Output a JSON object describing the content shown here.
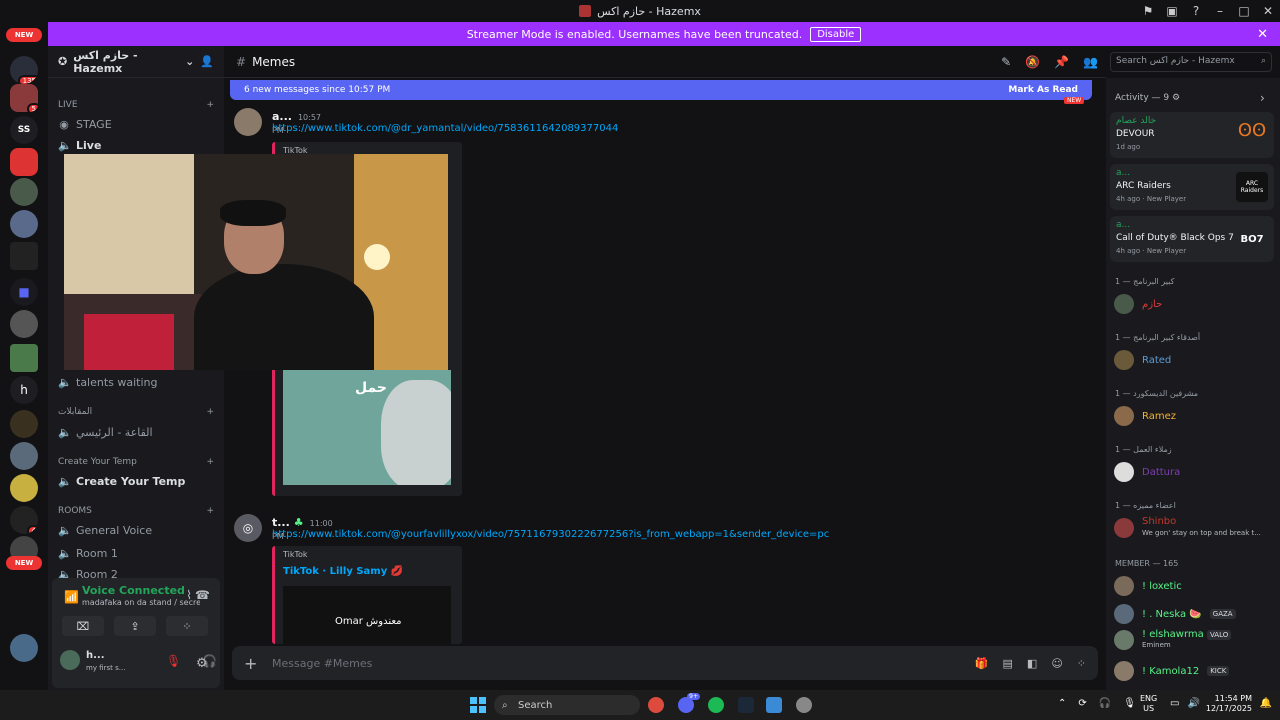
{
  "window": {
    "title": "حازم اكس - Hazemx"
  },
  "banner": {
    "text": "Streamer Mode is enabled. Usernames have been truncated.",
    "button": "Disable"
  },
  "rail": {
    "new_top": "NEW",
    "badge_135": "135",
    "badge_5": "5",
    "ss_label": "SS",
    "badge_4a": "4",
    "h_label": "h",
    "badge_4b": "4",
    "new_bottom": "NEW"
  },
  "sidebar": {
    "server_name": "حازم اكس - Hazemx",
    "cat_live": "LIVE",
    "stage": "STAGE",
    "live": "Live",
    "talents_waiting": "talents waiting",
    "cat_interviews": "المقابلات",
    "interview_room": "القاعة - الرئيسي",
    "cat_temp": "Create Your Temp",
    "create_temp": "Create Your Temp",
    "cat_rooms": "ROOMS",
    "general_voice": "General Voice",
    "room1": "Room 1",
    "room2": "Room 2"
  },
  "voice": {
    "title": "Voice Connected",
    "sub": "madafaka on da stand / secret s..."
  },
  "userbar": {
    "name": "h...",
    "status": "my first s..."
  },
  "channel": {
    "name": "Memes",
    "new_messages": "6 new messages since 10:57 PM",
    "mark_read": "Mark As Read",
    "new_tag": "NEW"
  },
  "messages": [
    {
      "user": "a...",
      "time": "10:57 PM",
      "link": "https://www.tiktok.com/@dr_yamantal/video/7583611642089377044",
      "provider": "TikTok",
      "overlay": "حمل"
    },
    {
      "user": "t...",
      "time": "11:00 PM",
      "link": "https://www.tiktok.com/@yourfavlillyxox/video/7571167930222677256?is_from_webapp=1&sender_device=pc",
      "provider": "TikTok",
      "title": "TikTok · Lilly Samy 💋",
      "overlay": "Omar معندوش"
    }
  ],
  "composer": {
    "placeholder": "Message #Memes"
  },
  "search": {
    "placeholder": "Search حازم اكس - Hazemx"
  },
  "activity": {
    "header": "Activity — 9",
    "items": [
      {
        "user": "خالد عصام",
        "game": "DEVOUR",
        "meta": "1d ago"
      },
      {
        "user": "a...",
        "game": "ARC Raiders",
        "meta": "4h ago",
        "tag": "New Player",
        "gicon": "ARC Raiders"
      },
      {
        "user": "a...",
        "game": "Call of Duty® Black Ops 7",
        "meta": "4h ago",
        "tag": "New Player",
        "gicon": "BO7"
      }
    ]
  },
  "members": {
    "groups": [
      {
        "title": "كبير البرنامج — 1",
        "name": "حازم",
        "color": "#d83c3e"
      },
      {
        "title": "أصدقاء كبير البرنامج — 1",
        "name": "Rated",
        "color": "#5b9bd5"
      },
      {
        "title": "مشرفين الديسكورد — 1",
        "name": "Ramez",
        "color": "#f0b232"
      },
      {
        "title": "زملاء العمل — 1",
        "name": "Dattura",
        "color": "#7b3fb0"
      },
      {
        "title": "اعضاء مميزه — 1",
        "name": "Shinbo",
        "color": "#c0392b",
        "status": "We gon' stay on top and break t..."
      }
    ],
    "member_header": "MEMBER — 165",
    "list": [
      {
        "name": "! loxetic",
        "color": "#57f287"
      },
      {
        "name": "! . Neska 🍉",
        "color": "#57f287",
        "tag": "GAZA"
      },
      {
        "name": "! elshawrma",
        "color": "#57f287",
        "tag": "VALO",
        "sub": "Eminem"
      },
      {
        "name": "! Kamola12",
        "color": "#57f287",
        "tag": "KICK"
      }
    ]
  },
  "taskbar": {
    "search": "Search",
    "lang1": "ENG",
    "lang2": "US",
    "time": "11:54 PM",
    "date": "12/17/2025",
    "discord_badge": "9+"
  }
}
